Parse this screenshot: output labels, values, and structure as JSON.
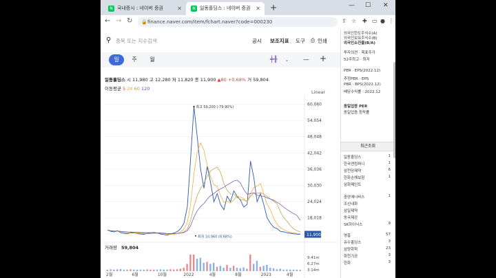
{
  "browser": {
    "tabs": [
      {
        "title": "국내증시 : 네이버 증권",
        "active": false
      },
      {
        "title": "일동홀딩스 : 네이버 증권",
        "active": true
      }
    ],
    "url": "finance.naver.com/item/fchart.naver?code=000230"
  },
  "toolbar": {
    "search_placeholder": "종목 또는 지수검색",
    "notice": "공시",
    "indicator": "보조지표",
    "tools": "도구",
    "print": "인쇄"
  },
  "period_tabs": [
    "일",
    "주",
    "월"
  ],
  "quote": {
    "name": "일동홀딩스",
    "open_label": "시",
    "open": "11,980",
    "high_label": "고",
    "high": "12,280",
    "low_label": "저",
    "low": "11,820",
    "close_label": "종",
    "close": "11,900",
    "change": "▲80",
    "change_pct": "+0.68%",
    "volume_label": "거",
    "volume": "59,804"
  },
  "moving_avg": {
    "label": "이동평균",
    "periods": [
      "5",
      "20",
      "60",
      "120"
    ],
    "colors": [
      "#e0403a",
      "#f0a030",
      "#b39b3a",
      "#6a4aa8"
    ]
  },
  "scale": "Linear",
  "volume_panel": {
    "label": "거래량",
    "value": "59,804"
  },
  "chart_data": {
    "type": "line",
    "title": "일동홀딩스",
    "y_ticks": [
      "60,060",
      "54,054",
      "48,048",
      "42,042",
      "36,036",
      "30,030",
      "24,024",
      "18,018",
      "12,012"
    ],
    "ylim": [
      10000,
      62000
    ],
    "x_ticks": [
      "2월",
      "6월",
      "10월",
      "2022",
      "4월",
      "8월",
      "2023",
      "4월"
    ],
    "current_price": "11,900",
    "high_annotation": "최고 59,200 (-79.90%)",
    "low_annotation": "최저 10,960 (8.68%)",
    "volume_ticks": [
      "9.41m",
      "6.27m",
      "3.14m"
    ],
    "series": [
      {
        "name": "종가",
        "color": "#2a59a8",
        "values": [
          13500,
          13000,
          12800,
          13200,
          12500,
          12300,
          12100,
          12600,
          12400,
          12200,
          12000,
          11900,
          12300,
          12500,
          12600,
          12400,
          12000,
          11800,
          11600,
          12100,
          12400,
          12900,
          14000,
          16000,
          22000,
          40000,
          59200,
          48000,
          36000,
          29000,
          37000,
          31000,
          24000,
          27000,
          23000,
          21000,
          26000,
          24000,
          28000,
          26000,
          24500,
          22000,
          23000,
          39000,
          33000,
          24000,
          27000,
          23000,
          18000,
          16000,
          14500,
          14000,
          13000,
          12800,
          12500,
          12300,
          12100,
          12000,
          11900
        ]
      }
    ]
  },
  "sidebar": {
    "lines": [
      "외국인한도주식수(A)",
      "외국인보유주식수(B)",
      "외국인소진율(B/A)",
      "투자의견 · 목표주가",
      "52주최고 · 최저",
      "PER · EPS(2022.12)",
      "추정PER · EPS",
      "PBR · BPS(2022.12)",
      "배당수익률 · 2022.12",
      "동일업종 PER",
      "동일업종 등락률"
    ],
    "recent_title": "최근조회",
    "recent": [
      {
        "name": "일동홀딩스",
        "count": "1"
      },
      {
        "name": "한국앤컴퍼니",
        "count": "1"
      },
      {
        "name": "삼천당제약",
        "count": "6"
      },
      {
        "name": "한화손해보험",
        "count": "1"
      },
      {
        "name": "삼화페인트",
        "count": ""
      },
      {
        "name": "중앙에너비스",
        "count": "1"
      },
      {
        "name": "조선내화",
        "count": ""
      },
      {
        "name": "삼일제약",
        "count": ""
      },
      {
        "name": "동국제강",
        "count": ""
      },
      {
        "name": "SK하이닉스",
        "count": "9"
      },
      {
        "name": "영흥",
        "count": "57"
      },
      {
        "name": "유수홀딩스",
        "count": "3"
      },
      {
        "name": "삼양화학",
        "count": "23"
      },
      {
        "name": "화천기공",
        "count": "3"
      },
      {
        "name": "한화",
        "count": "3"
      }
    ]
  }
}
